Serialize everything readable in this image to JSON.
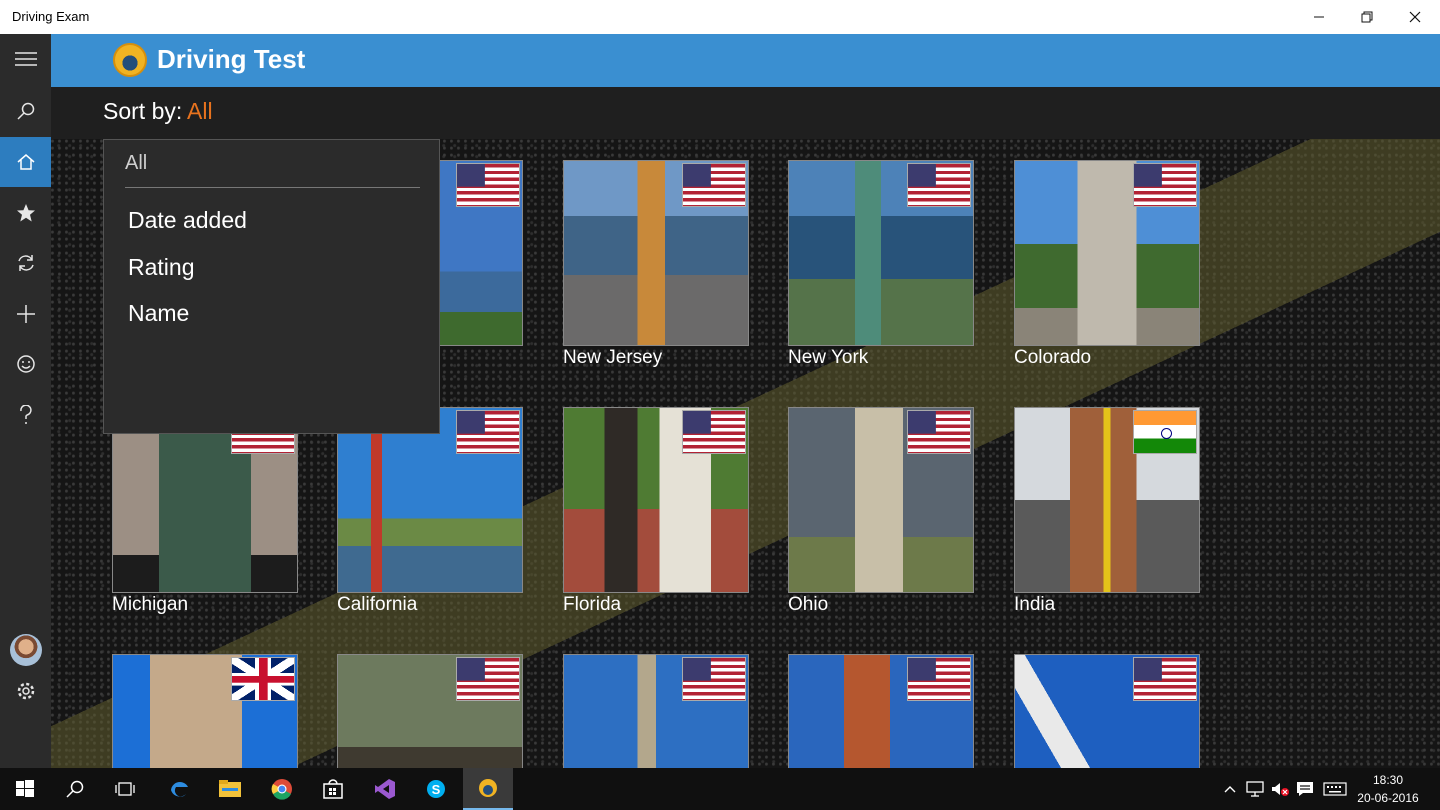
{
  "window": {
    "title": "Driving Exam"
  },
  "app": {
    "title": "Driving Test"
  },
  "sort": {
    "label": "Sort by:",
    "value": "All"
  },
  "dropdown": {
    "selected": "All",
    "options": [
      "Date added",
      "Rating",
      "Name"
    ]
  },
  "nav": {
    "items": [
      "menu-icon",
      "search-icon",
      "home-icon",
      "star-icon",
      "refresh-icon",
      "add-icon",
      "smiley-icon",
      "help-icon",
      "settings-icon"
    ],
    "active": "home-icon",
    "accent_color": "#2d7dbf"
  },
  "tiles": [
    {
      "caption": "",
      "flag": "us",
      "photo": "water-landscape"
    },
    {
      "caption": "New Jersey",
      "flag": "us",
      "photo": "memorial-monument"
    },
    {
      "caption": "New York",
      "flag": "us",
      "photo": "statue-of-liberty"
    },
    {
      "caption": "Colorado",
      "flag": "us",
      "photo": "stone-monument"
    },
    {
      "caption": "Michigan",
      "flag": "us",
      "photo": "bronze-statue"
    },
    {
      "caption": "California",
      "flag": "us",
      "photo": "golden-gate-bridge"
    },
    {
      "caption": "Florida",
      "flag": "us",
      "photo": "statue-with-pedestal"
    },
    {
      "caption": "Ohio",
      "flag": "us",
      "photo": "tribute-monument"
    },
    {
      "caption": "India",
      "flag": "in",
      "photo": "india-gate"
    },
    {
      "caption": "",
      "flag": "uk",
      "photo": "tower-bridge"
    },
    {
      "caption": "",
      "flag": "us",
      "photo": "bronze-figures"
    },
    {
      "caption": "",
      "flag": "us",
      "photo": "column-monument"
    },
    {
      "caption": "",
      "flag": "us",
      "photo": "red-rock-statue"
    },
    {
      "caption": "",
      "flag": "us",
      "photo": "obelisk-monument"
    }
  ],
  "colors": {
    "header": "#3a8fd1",
    "sort_accent": "#e8731e",
    "rail": "#2b2b2b"
  },
  "taskbar": {
    "apps": [
      "windows-icon",
      "search-icon",
      "task-view-icon",
      "edge-icon",
      "file-explorer-icon",
      "chrome-icon",
      "store-icon",
      "visual-studio-icon",
      "skype-icon",
      "driving-exam-app-icon"
    ],
    "active": "driving-exam-app-icon",
    "tray": [
      "chevron-up-icon",
      "network-icon",
      "volume-muted-icon",
      "action-center-icon",
      "keyboard-icon"
    ],
    "time": "18:30",
    "date": "20-06-2016"
  }
}
